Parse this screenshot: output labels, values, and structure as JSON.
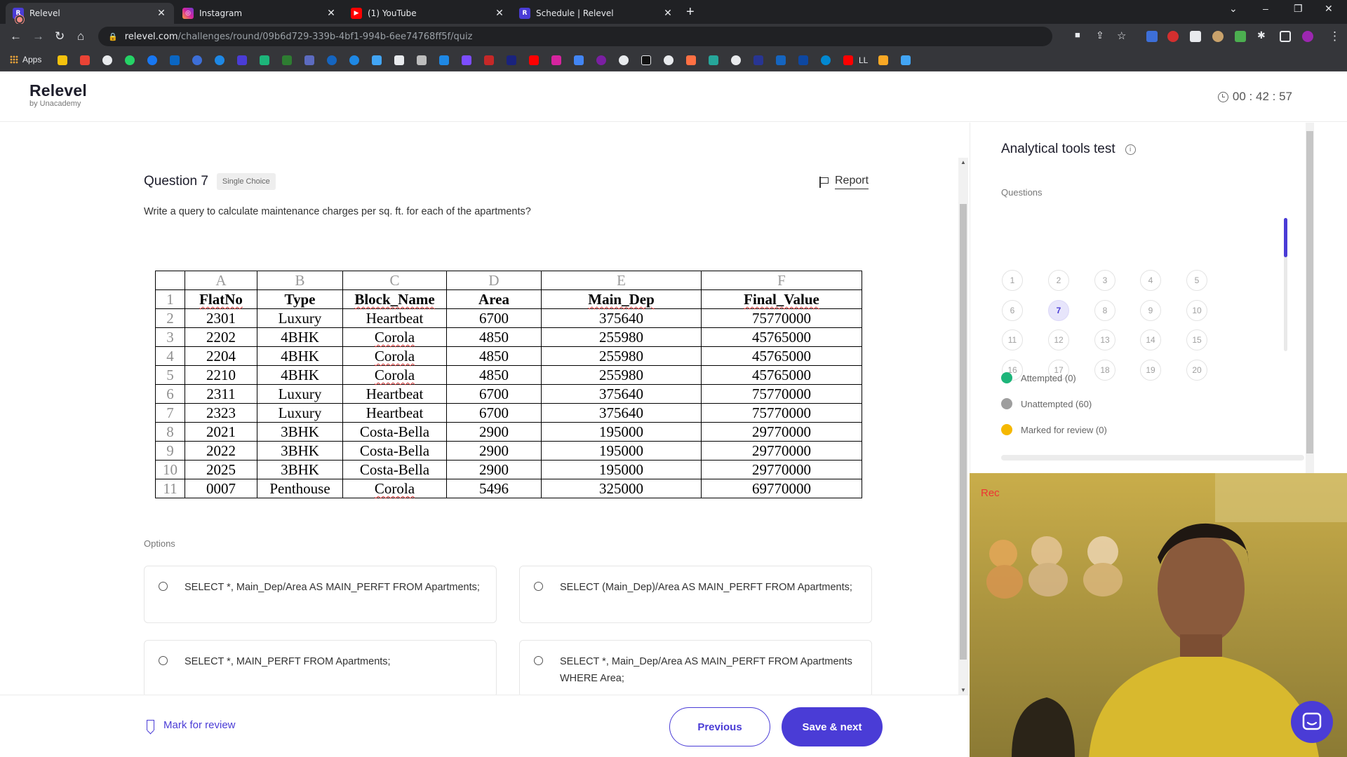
{
  "browser": {
    "tabs": [
      {
        "title": "Relevel",
        "active": true
      },
      {
        "title": "Instagram",
        "active": false
      },
      {
        "title": "(1) YouTube",
        "active": false
      },
      {
        "title": "Schedule | Relevel",
        "active": false
      }
    ],
    "url_domain": "relevel.com",
    "url_path": "/challenges/round/09b6d729-339b-4bf1-994b-6ee74768ff5f/quiz",
    "bookmarks_apps": "Apps",
    "bookmark_ll": "LL"
  },
  "header": {
    "brand": "Relevel",
    "brand_sub": "by Unacademy",
    "timer": "00 : 42 : 57"
  },
  "question": {
    "title": "Question 7",
    "type_badge": "Single Choice",
    "report": "Report",
    "text": "Write a query to calculate maintenance charges per sq. ft. for each of the apartments?"
  },
  "sheet": {
    "col_letters": [
      "A",
      "B",
      "C",
      "D",
      "E",
      "F"
    ],
    "headers": [
      "FlatNo",
      "Type",
      "Block_Name",
      "Area",
      "Main_Dep",
      "Final_Value"
    ],
    "rows": [
      [
        "2301",
        "Luxury",
        "Heartbeat",
        "6700",
        "375640",
        "75770000"
      ],
      [
        "2202",
        "4BHK",
        "Corola",
        "4850",
        "255980",
        "45765000"
      ],
      [
        "2204",
        "4BHK",
        "Corola",
        "4850",
        "255980",
        "45765000"
      ],
      [
        "2210",
        "4BHK",
        "Corola",
        "4850",
        "255980",
        "45765000"
      ],
      [
        "2311",
        "Luxury",
        "Heartbeat",
        "6700",
        "375640",
        "75770000"
      ],
      [
        "2323",
        "Luxury",
        "Heartbeat",
        "6700",
        "375640",
        "75770000"
      ],
      [
        "2021",
        "3BHK",
        "Costa-Bella",
        "2900",
        "195000",
        "29770000"
      ],
      [
        "2022",
        "3BHK",
        "Costa-Bella",
        "2900",
        "195000",
        "29770000"
      ],
      [
        "2025",
        "3BHK",
        "Costa-Bella",
        "2900",
        "195000",
        "29770000"
      ],
      [
        "0007",
        "Penthouse",
        "Corola",
        "5496",
        "325000",
        "69770000"
      ]
    ]
  },
  "options": {
    "label": "Options",
    "items": [
      "SELECT *, Main_Dep/Area AS MAIN_PERFT FROM Apartments;",
      "SELECT (Main_Dep)/Area AS MAIN_PERFT FROM Apartments;",
      "SELECT *, MAIN_PERFT FROM Apartments;",
      "SELECT *, Main_Dep/Area AS MAIN_PERFT FROM Apartments WHERE Area;"
    ]
  },
  "footer": {
    "mark_review": "Mark for review",
    "previous": "Previous",
    "save_next": "Save & next"
  },
  "sidebar": {
    "title": "Analytical tools test",
    "questions_label": "Questions",
    "question_numbers": [
      "1",
      "2",
      "3",
      "4",
      "5",
      "6",
      "7",
      "8",
      "9",
      "10",
      "11",
      "12",
      "13",
      "14",
      "15",
      "16",
      "17",
      "18",
      "19",
      "20"
    ],
    "current": "7",
    "legend": {
      "attempted": "Attempted (0)",
      "unattempted": "Unattempted (60)",
      "marked": "Marked for review (0)"
    }
  },
  "webcam": {
    "rec_label": "Rec"
  },
  "colors": {
    "accent": "#4a3cd6",
    "attempted": "#1db57a",
    "unattempted": "#9e9e9e",
    "marked": "#f5b800"
  }
}
